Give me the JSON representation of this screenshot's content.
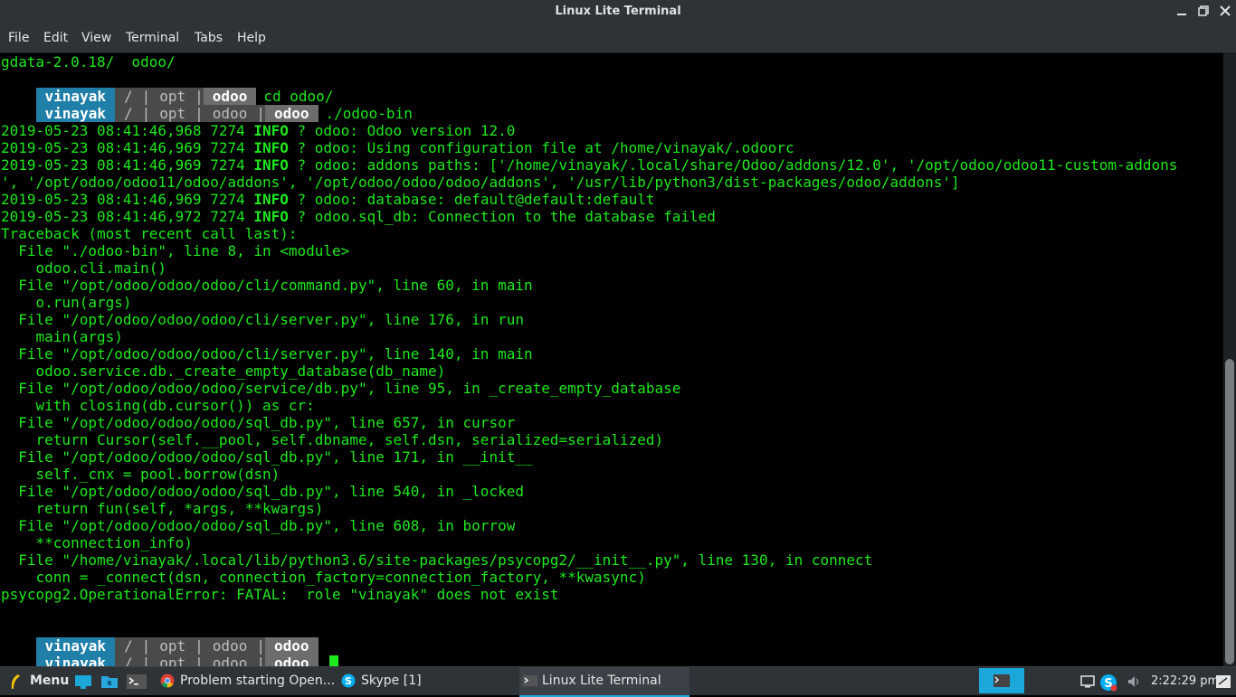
{
  "window": {
    "title": "Linux Lite Terminal"
  },
  "menubar": {
    "items": [
      "File",
      "Edit",
      "View",
      "Terminal",
      "Tabs",
      "Help"
    ]
  },
  "terminal": {
    "first_line": "gdata-2.0.18/  odoo/",
    "prompts": [
      {
        "user": "vinayak",
        "slash": "/",
        "dirs": [
          "opt"
        ],
        "current": "odoo",
        "command": "cd odoo/"
      },
      {
        "user": "vinayak",
        "slash": "/",
        "dirs": [
          "opt",
          "odoo"
        ],
        "current": "odoo",
        "command": "./odoo-bin"
      }
    ],
    "log_lines": [
      {
        "prefix": "2019-05-23 08:41:46,968 7274 ",
        "level": "INFO",
        "msg": " ? odoo: Odoo version 12.0"
      },
      {
        "prefix": "2019-05-23 08:41:46,969 7274 ",
        "level": "INFO",
        "msg": " ? odoo: Using configuration file at /home/vinayak/.odoorc"
      },
      {
        "prefix": "2019-05-23 08:41:46,969 7274 ",
        "level": "INFO",
        "msg": " ? odoo: addons paths: ['/home/vinayak/.local/share/Odoo/addons/12.0', '/opt/odoo/odoo11-custom-addons"
      },
      {
        "prefix": "",
        "level": "",
        "msg": "', '/opt/odoo/odoo11/odoo/addons', '/opt/odoo/odoo/odoo/addons', '/usr/lib/python3/dist-packages/odoo/addons']"
      },
      {
        "prefix": "2019-05-23 08:41:46,969 7274 ",
        "level": "INFO",
        "msg": " ? odoo: database: default@default:default"
      },
      {
        "prefix": "2019-05-23 08:41:46,972 7274 ",
        "level": "INFO",
        "msg": " ? odoo.sql_db: Connection to the database failed"
      }
    ],
    "traceback": [
      "Traceback (most recent call last):",
      "  File \"./odoo-bin\", line 8, in <module>",
      "    odoo.cli.main()",
      "  File \"/opt/odoo/odoo/odoo/cli/command.py\", line 60, in main",
      "    o.run(args)",
      "  File \"/opt/odoo/odoo/odoo/cli/server.py\", line 176, in run",
      "    main(args)",
      "  File \"/opt/odoo/odoo/odoo/cli/server.py\", line 140, in main",
      "    odoo.service.db._create_empty_database(db_name)",
      "  File \"/opt/odoo/odoo/odoo/service/db.py\", line 95, in _create_empty_database",
      "    with closing(db.cursor()) as cr:",
      "  File \"/opt/odoo/odoo/odoo/sql_db.py\", line 657, in cursor",
      "    return Cursor(self.__pool, self.dbname, self.dsn, serialized=serialized)",
      "  File \"/opt/odoo/odoo/odoo/sql_db.py\", line 171, in __init__",
      "    self._cnx = pool.borrow(dsn)",
      "  File \"/opt/odoo/odoo/odoo/sql_db.py\", line 540, in _locked",
      "    return fun(self, *args, **kwargs)",
      "  File \"/opt/odoo/odoo/odoo/sql_db.py\", line 608, in borrow",
      "    **connection_info)",
      "  File \"/home/vinayak/.local/lib/python3.6/site-packages/psycopg2/__init__.py\", line 130, in connect",
      "    conn = _connect(dsn, connection_factory=connection_factory, **kwasync)",
      "psycopg2.OperationalError: FATAL:  role \"vinayak\" does not exist"
    ],
    "final_prompt": {
      "user": "vinayak",
      "slash": "/",
      "dirs": [
        "opt",
        "odoo"
      ],
      "current": "odoo"
    },
    "text_color": "#1ee81e"
  },
  "taskbar": {
    "menu_label": "Menu",
    "tasks": [
      {
        "label": "Problem starting Open...",
        "icon": "chrome-icon"
      },
      {
        "label": "Skype [1]",
        "icon": "skype-icon"
      },
      {
        "label": "Linux Lite Terminal",
        "icon": "terminal-icon"
      }
    ],
    "clock": "2:22:29 pm"
  }
}
